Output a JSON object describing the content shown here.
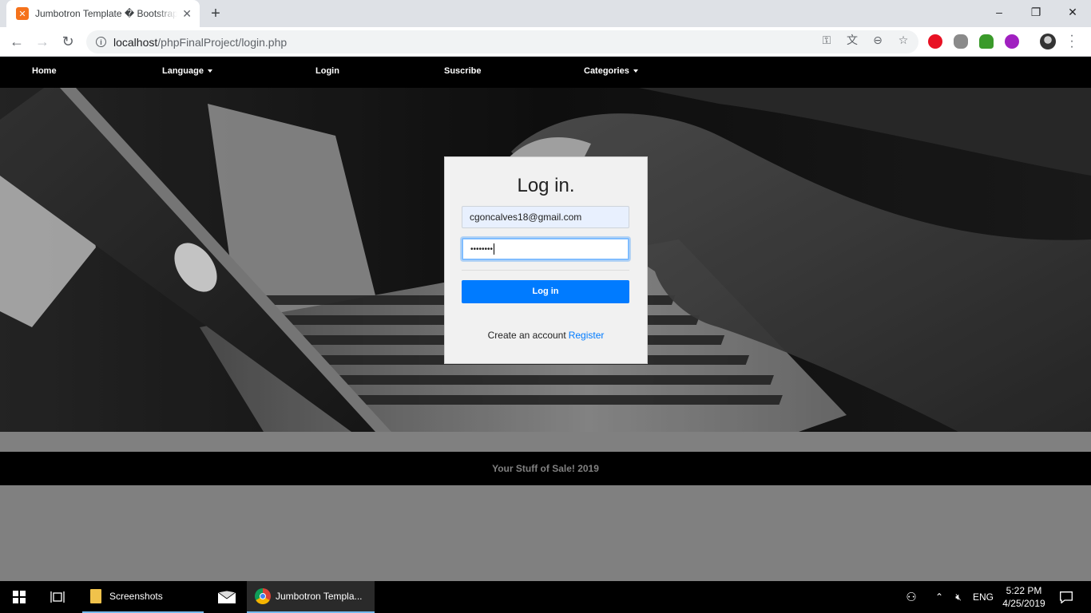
{
  "browser": {
    "tab_title": "Jumbotron Template � Bootstrap",
    "tab_favicon": "xampp-icon",
    "url_host": "localhost",
    "url_path": "/phpFinalProject/login.php"
  },
  "nav": {
    "home": "Home",
    "language": "Language",
    "login": "Login",
    "subscribe": "Suscribe",
    "categories": "Categories"
  },
  "login": {
    "title": "Log in.",
    "email_value": "cgoncalves18@gmail.com",
    "password_mask": "••••••••",
    "button": "Log in",
    "create_text": "Create an account",
    "register_link": "Register"
  },
  "footer": {
    "text": "Your Stuff of Sale! 2019"
  },
  "taskbar": {
    "screenshots": "Screenshots",
    "chrome": "Jumbotron Templa...",
    "lang": "ENG",
    "time": "5:22 PM",
    "date": "4/25/2019"
  },
  "colors": {
    "primary": "#007bff",
    "navbar": "#000000",
    "page_bg": "#808080"
  }
}
